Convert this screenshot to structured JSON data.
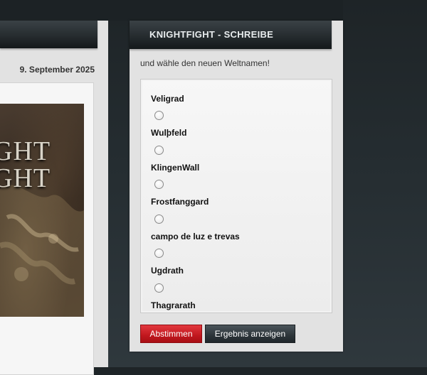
{
  "news": {
    "date": "9. September 2025",
    "image_text_line1": "GHT",
    "image_text_line2": "GHT"
  },
  "poll": {
    "title": "KNIGHTFIGHT - SCHREIBE",
    "subtitle": "und wähle den neuen Weltnamen!",
    "options": [
      {
        "label": "Veligrad"
      },
      {
        "label": "Wulþfeld"
      },
      {
        "label": "KlingenWall"
      },
      {
        "label": "Frostfanggard"
      },
      {
        "label": "campo de luz e trevas"
      },
      {
        "label": "Ugdrath"
      },
      {
        "label": "Thagrarath"
      }
    ],
    "vote_button": "Abstimmen",
    "result_button": "Ergebnis anzeigen"
  },
  "colors": {
    "vote_button": "#c1171e",
    "result_button": "#2d353a",
    "header": "#262c2f"
  }
}
